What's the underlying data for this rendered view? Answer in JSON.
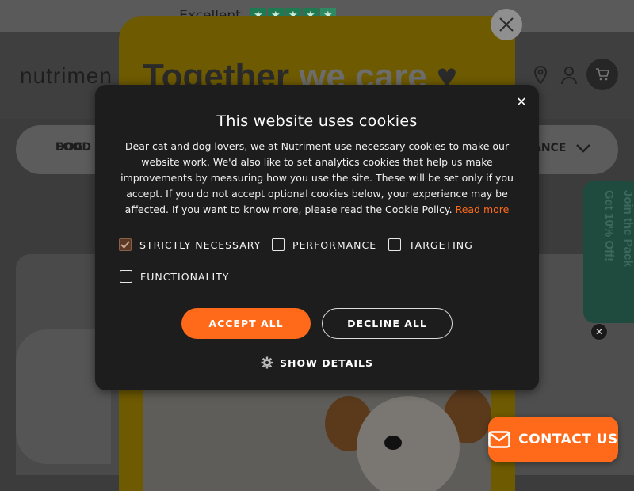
{
  "topbar": {
    "rating": "Excellent",
    "stars": 5
  },
  "header": {
    "logo": "nutrimen"
  },
  "nav": {
    "dog_food_line1": "DOG",
    "dog_food_line2": "FOOD",
    "right_partial": "ANCE"
  },
  "promo": {
    "title_part1": "Together",
    "title_part2": "we care"
  },
  "join": {
    "line1": "Join the Pack",
    "line2": "Get 10% Off!"
  },
  "cookie": {
    "title": "This website uses cookies",
    "body": "Dear cat and dog lovers, we at Nutriment use necessary cookies to make our website work. We'd also like to set analytics cookies that help us make improvements by measuring how you use the site. These will be set only if you accept. If you do not accept optional cookies below, your experience may be affected. If you want to know more, please read the Cookie Policy.",
    "read_more": "Read more",
    "options": [
      {
        "label": "STRICTLY NECESSARY",
        "checked": true
      },
      {
        "label": "PERFORMANCE",
        "checked": false
      },
      {
        "label": "TARGETING",
        "checked": false
      },
      {
        "label": "FUNCTIONALITY",
        "checked": false
      }
    ],
    "accept_label": "ACCEPT ALL",
    "decline_label": "DECLINE ALL",
    "show_details_label": "SHOW DETAILS",
    "accent_color": "#ff6a1a"
  },
  "contact": {
    "label": "CONTACT US"
  }
}
